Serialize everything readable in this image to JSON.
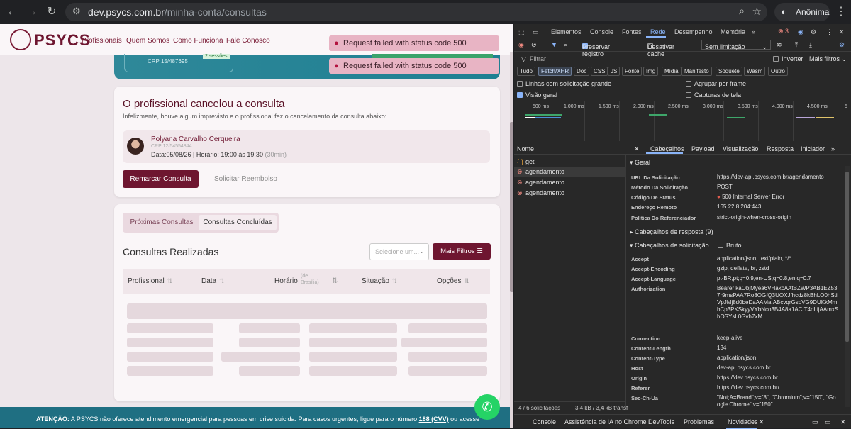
{
  "browser": {
    "url_domain": "dev.psycs.com.br",
    "url_path": "/minha-conta/consultas",
    "profile_label": "Anônima"
  },
  "site": {
    "logo_text": "PSYCS",
    "menu": [
      "Profissionais",
      "Quem Somos",
      "Como Funciona",
      "Fale Conosco"
    ],
    "toasts": [
      "Request failed with status code 500",
      "Request failed with status code 500"
    ],
    "hero": {
      "crp": "CRP 15/487695",
      "badge": "2 sessões"
    }
  },
  "cancel_card": {
    "title": "O profissional cancelou a consulta",
    "subtitle": "Infelizmente, houve algum imprevisto e o profissional fez o cancelamento da consulta abaixo:",
    "professional_name": "Polyana Carvalho Cerqueira",
    "professional_crp": "CRP 12/54554844",
    "date_line": "Data:05/08/26 | Horário: 19:00 às 19:30",
    "duration": "(30min)",
    "primary_button": "Remarcar Consulta",
    "secondary_button": "Solicitar Reembolso"
  },
  "consultas_card": {
    "tabs": [
      "Próximas Consultas",
      "Consultas Concluídas"
    ],
    "active_tab": 1,
    "title": "Consultas Realizadas",
    "select_placeholder": "Selecione um...",
    "filter_button": "Mais Filtros",
    "columns": [
      "Profissional",
      "Data",
      "Horário",
      "Situação",
      "Opções"
    ],
    "horario_sub": "(de Brasília)"
  },
  "footer": {
    "prefix": "ATENÇÃO:",
    "text": " A PSYCS não oferece atendimento emergencial para pessoas em crise suicida. Para casos urgentes, ligue para o número ",
    "number": "188 (CVV)",
    "suffix": " ou acesse"
  },
  "devtools": {
    "tabs": [
      "Elementos",
      "Console",
      "Fontes",
      "Rede",
      "Desempenho",
      "Memória"
    ],
    "active_tab": "Rede",
    "error_count": "3",
    "preserve_log": "Preservar registro",
    "disable_cache": "Desativar cache",
    "throttle": "Sem limitação",
    "filter_placeholder": "Filtrar",
    "invert": "Inverter",
    "more_filters": "Mais filtros",
    "type_filters": [
      "Tudo",
      "Fetch/XHR",
      "Doc",
      "CSS",
      "JS",
      "Fonte",
      "Img",
      "Mídia",
      "Manifesto",
      "Soquete",
      "Wasm",
      "Outro"
    ],
    "active_type": "Fetch/XHR",
    "options": {
      "large_rows": "Linhas com solicitação grande",
      "group_frame": "Agrupar por frame",
      "overview": "Visão geral",
      "screenshots": "Capturas de tela"
    },
    "timeline_ticks": [
      "500 ms",
      "1.000 ms",
      "1.500 ms",
      "2.000 ms",
      "2.500 ms",
      "3.000 ms",
      "3.500 ms",
      "4.000 ms",
      "4.500 ms",
      "5"
    ],
    "name_header": "Nome",
    "requests": [
      {
        "name": "get",
        "failed": false
      },
      {
        "name": "agendamento",
        "failed": true
      },
      {
        "name": "agendamento",
        "failed": true
      },
      {
        "name": "agendamento",
        "failed": true
      }
    ],
    "detail_tabs": [
      "Cabeçalhos",
      "Payload",
      "Visualização",
      "Resposta",
      "Iniciador"
    ],
    "general_title": "Geral",
    "general": [
      {
        "k": "URL Da Solicitação",
        "v": "https://dev-api.psycs.com.br/agendamento"
      },
      {
        "k": "Método Da Solicitação",
        "v": "POST"
      },
      {
        "k": "Código De Status",
        "v": "500 Internal Server Error"
      },
      {
        "k": "Endereço Remoto",
        "v": "165.22.8.204:443"
      },
      {
        "k": "Política Do Referenciador",
        "v": "strict-origin-when-cross-origin"
      }
    ],
    "response_headers": "Cabeçalhos de resposta (9)",
    "request_headers": "Cabeçalhos de solicitação",
    "raw": "Bruto",
    "req_headers": [
      {
        "k": "Accept",
        "v": "application/json, text/plain, */*"
      },
      {
        "k": "Accept-Encoding",
        "v": "gzip, deflate, br, zstd"
      },
      {
        "k": "Accept-Language",
        "v": "pt-BR,pt;q=0.9,en-US;q=0.8,en;q=0.7"
      },
      {
        "k": "Authorization",
        "v": "Bearer kaObjMyea6VHaxcAAtBZWP3AB1EZ537r9msPAA7Ro8OGfQ3UOXJfhcdz8kBhLO0hStiVpJMj8d0beDaAAMaIABcvqrGspVG9DUKkMmbCp3PKSkyyVYbNco3B4A8a1ACtT4dLijAAmxShOSYsL0Gvh7xM"
      },
      {
        "k": "Connection",
        "v": "keep-alive"
      },
      {
        "k": "Content-Length",
        "v": "134"
      },
      {
        "k": "Content-Type",
        "v": "application/json"
      },
      {
        "k": "Host",
        "v": "dev-api.psycs.com.br"
      },
      {
        "k": "Origin",
        "v": "https://dev.psycs.com.br"
      },
      {
        "k": "Referer",
        "v": "https://dev.psycs.com.br/"
      },
      {
        "k": "Sec-Ch-Ua",
        "v": "\"Not;A=Brand\";v=\"8\", \"Chromium\";v=\"150\", \"Google Chrome\";v=\"150\""
      }
    ],
    "status_bar": "4 / 6 solicitações",
    "status_bytes": "3,4 kB / 3,4 kB transf",
    "drawer_tabs": [
      "Console",
      "Assistência de IA no Chrome DevTools",
      "Problemas",
      "Novidades"
    ],
    "active_drawer": "Novidades"
  },
  "colors": {
    "brand": "#6e1630",
    "hero": "#1e7f92",
    "accent_blue": "#8ab4f8",
    "error": "#f28b82"
  }
}
